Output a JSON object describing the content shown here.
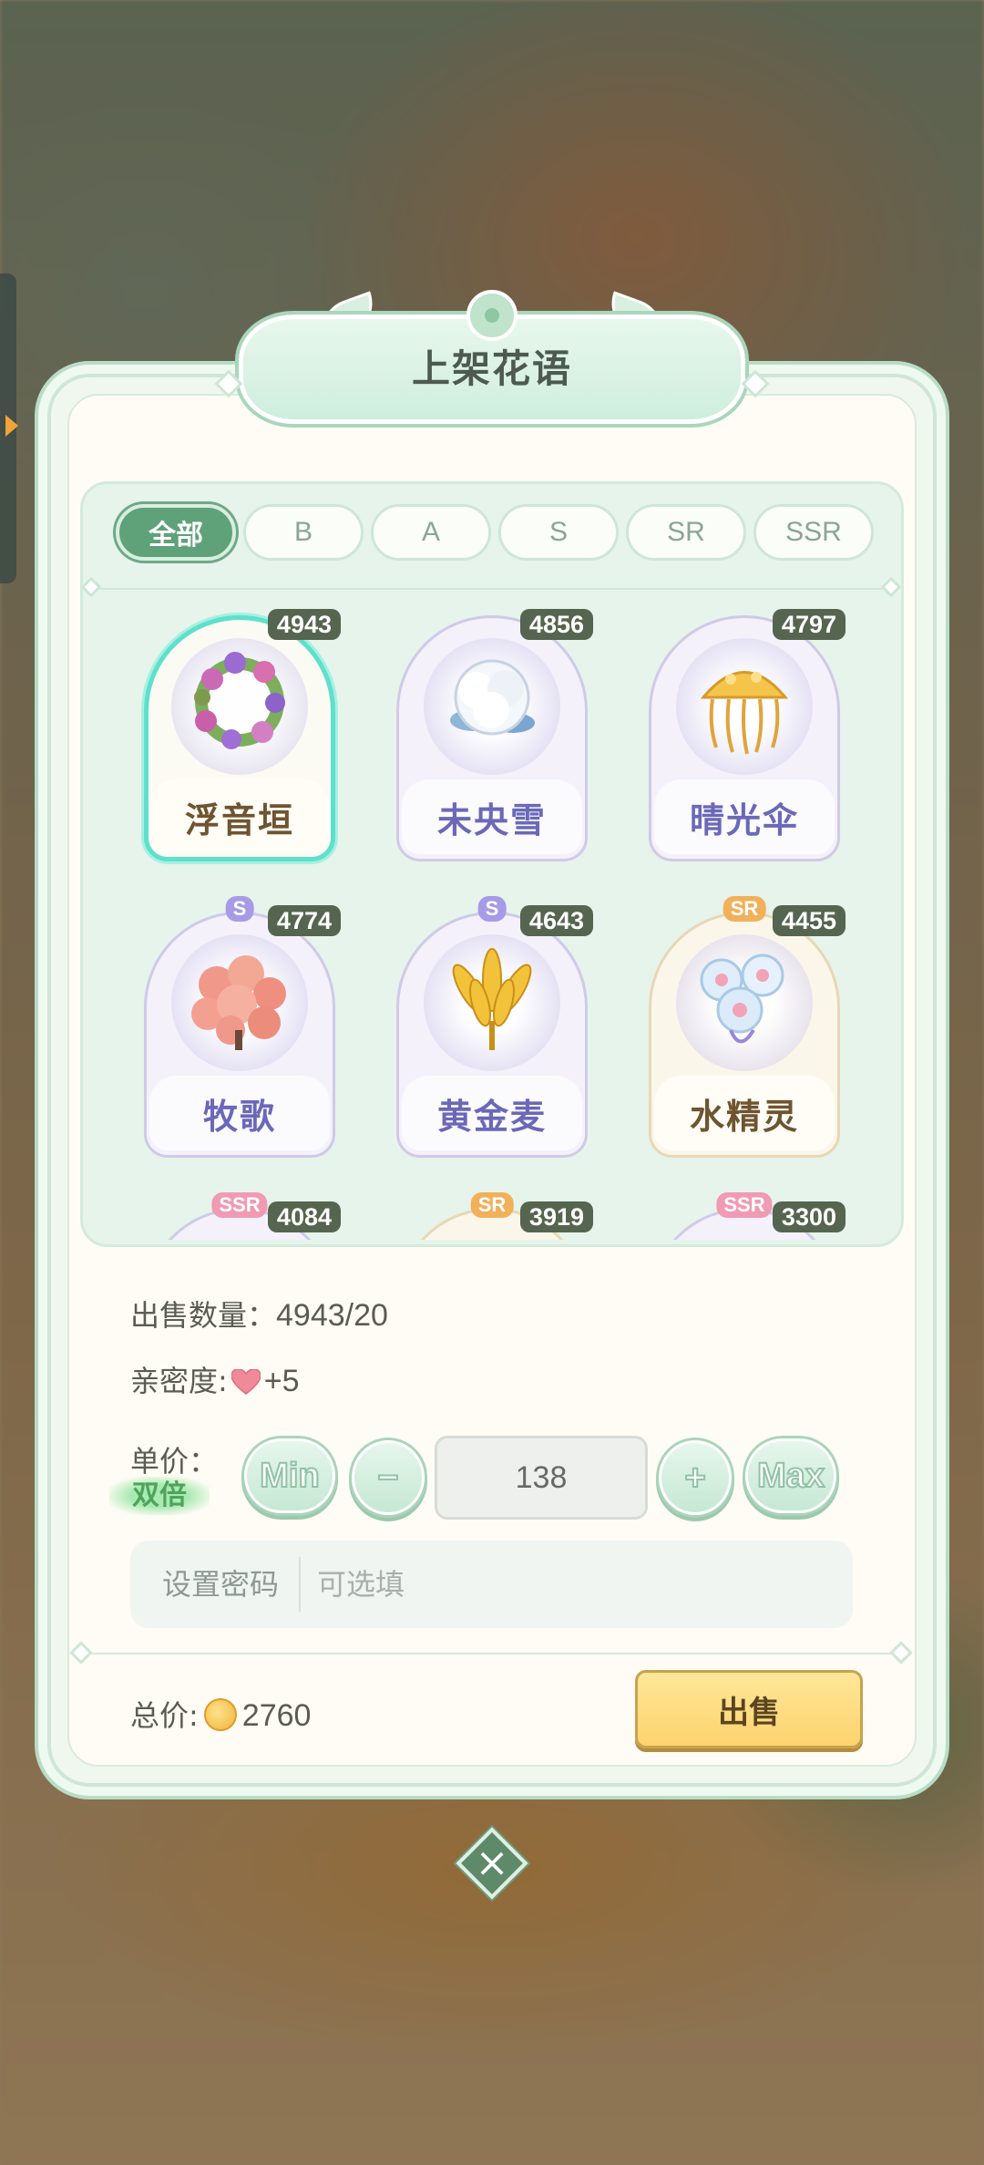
{
  "dialog": {
    "title": "上架花语",
    "tabs": [
      {
        "label": "全部",
        "active": true
      },
      {
        "label": "B",
        "active": false
      },
      {
        "label": "A",
        "active": false
      },
      {
        "label": "S",
        "active": false
      },
      {
        "label": "SR",
        "active": false
      },
      {
        "label": "SSR",
        "active": false
      }
    ],
    "items": [
      {
        "name": "浮音垣",
        "count": "4943",
        "rarity": "",
        "selected": true,
        "style": "gold",
        "icon": "wreath-flower-icon"
      },
      {
        "name": "未央雪",
        "count": "4856",
        "rarity": "",
        "selected": false,
        "style": "lilac",
        "icon": "cotton-flower-icon"
      },
      {
        "name": "晴光伞",
        "count": "4797",
        "rarity": "",
        "selected": false,
        "style": "lilac",
        "icon": "jellyfish-flower-icon"
      },
      {
        "name": "牧歌",
        "count": "4774",
        "rarity": "S",
        "selected": false,
        "style": "lilac",
        "icon": "pink-puff-flower-icon"
      },
      {
        "name": "黄金麦",
        "count": "4643",
        "rarity": "S",
        "selected": false,
        "style": "lilac",
        "icon": "golden-wheat-icon"
      },
      {
        "name": "水精灵",
        "count": "4455",
        "rarity": "SR",
        "selected": false,
        "style": "gold",
        "icon": "water-bubble-flower-icon"
      },
      {
        "name": "",
        "count": "4084",
        "rarity": "SSR",
        "selected": false,
        "style": "lilac",
        "icon": "flower-icon"
      },
      {
        "name": "",
        "count": "3919",
        "rarity": "SR",
        "selected": false,
        "style": "gold",
        "icon": "flower-icon"
      },
      {
        "name": "",
        "count": "3300",
        "rarity": "SSR",
        "selected": false,
        "style": "lilac",
        "icon": "flower-icon"
      }
    ],
    "sell_qty_label": "出售数量：",
    "sell_qty_value": "4943/20",
    "intimacy_label": "亲密度:",
    "intimacy_value": "+5",
    "unit_price_label": "单价：",
    "double_tag": "双倍",
    "min_label": "Min",
    "minus_label": "−",
    "price_value": "138",
    "plus_label": "+",
    "max_label": "Max",
    "password_label": "设置密码",
    "password_placeholder": "可选填",
    "total_label": "总价:",
    "total_value": "2760",
    "sell_button": "出售",
    "close_icon": "×"
  },
  "colors": {
    "accent_green": "#5fa27a",
    "count_badge": "#55654f",
    "sell_button": "#fdd36e",
    "selected_glow": "#5fe0cc",
    "rarity_S": "#a79ae6",
    "rarity_SR": "#f1b05a",
    "rarity_SSR": "#f09ab4"
  }
}
